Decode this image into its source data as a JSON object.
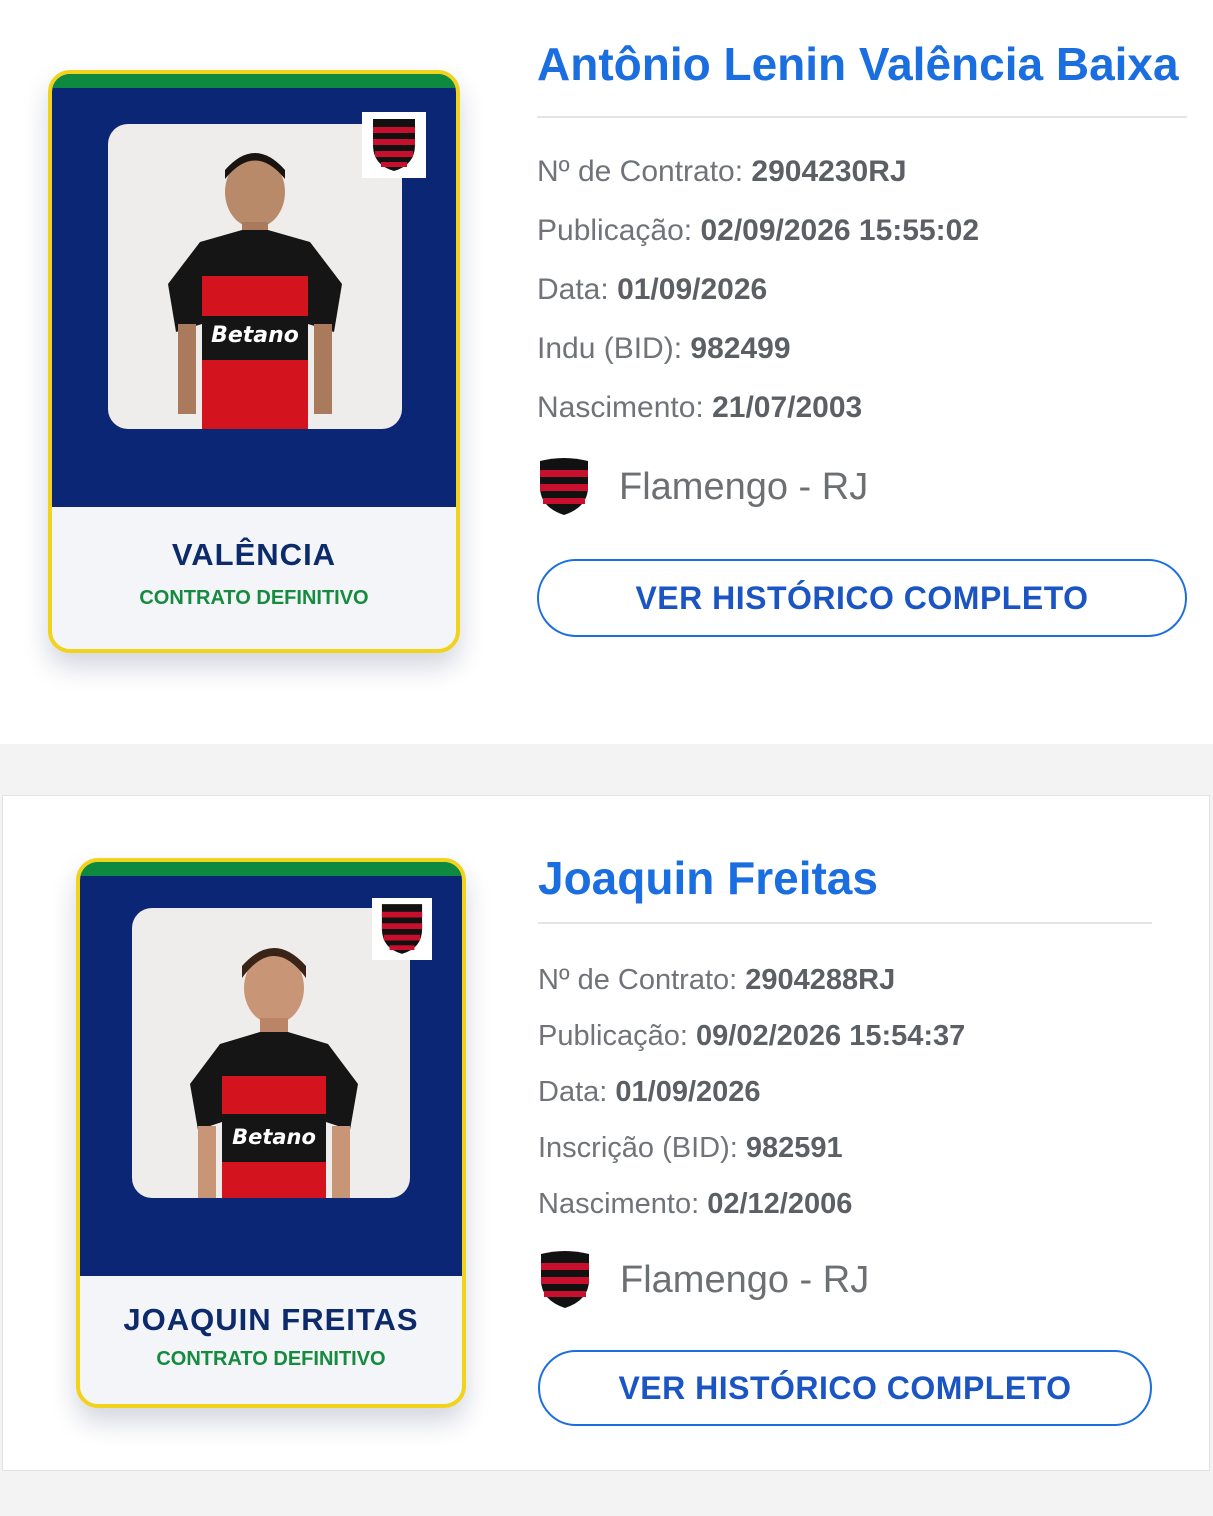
{
  "colors": {
    "card_border": "#f2d31b",
    "card_panel": "#0a2674",
    "card_stripe": "#0e8a40",
    "card_name": "#0d2a6b",
    "contract_status": "#168a3e",
    "link_blue": "#1b6ee0",
    "flamengo_red": "#c8102e",
    "flamengo_black": "#111111"
  },
  "players": [
    {
      "card_name": "VALÊNCIA",
      "contract_status": "CONTRATO DEFINITIVO",
      "full_name": "Antônio Lenin Valência Baixa",
      "club_icon": "flamengo-shield-icon",
      "fields": [
        {
          "label": "Nº de Contrato:",
          "value": "2904230RJ"
        },
        {
          "label": "Publicação:",
          "value": "02/09/2026 15:55:02"
        },
        {
          "label": "Data:",
          "value": "01/09/2026"
        },
        {
          "label": "Indu (BID):",
          "value": "982499"
        },
        {
          "label": "Nascimento:",
          "value": "21/07/2003"
        }
      ],
      "club": "Flamengo - RJ",
      "button_label": "VER HISTÓRICO COMPLETO"
    },
    {
      "card_name": "JOAQUIN FREITAS",
      "contract_status": "CONTRATO DEFINITIVO",
      "full_name": "Joaquin Freitas",
      "club_icon": "flamengo-shield-icon",
      "fields": [
        {
          "label": "Nº de Contrato:",
          "value": "2904288RJ"
        },
        {
          "label": "Publicação:",
          "value": "09/02/2026 15:54:37"
        },
        {
          "label": "Data:",
          "value": "01/09/2026"
        },
        {
          "label": "Inscrição (BID):",
          "value": "982591"
        },
        {
          "label": "Nascimento:",
          "value": "02/12/2006"
        }
      ],
      "club": "Flamengo - RJ",
      "button_label": "VER HISTÓRICO COMPLETO"
    }
  ]
}
